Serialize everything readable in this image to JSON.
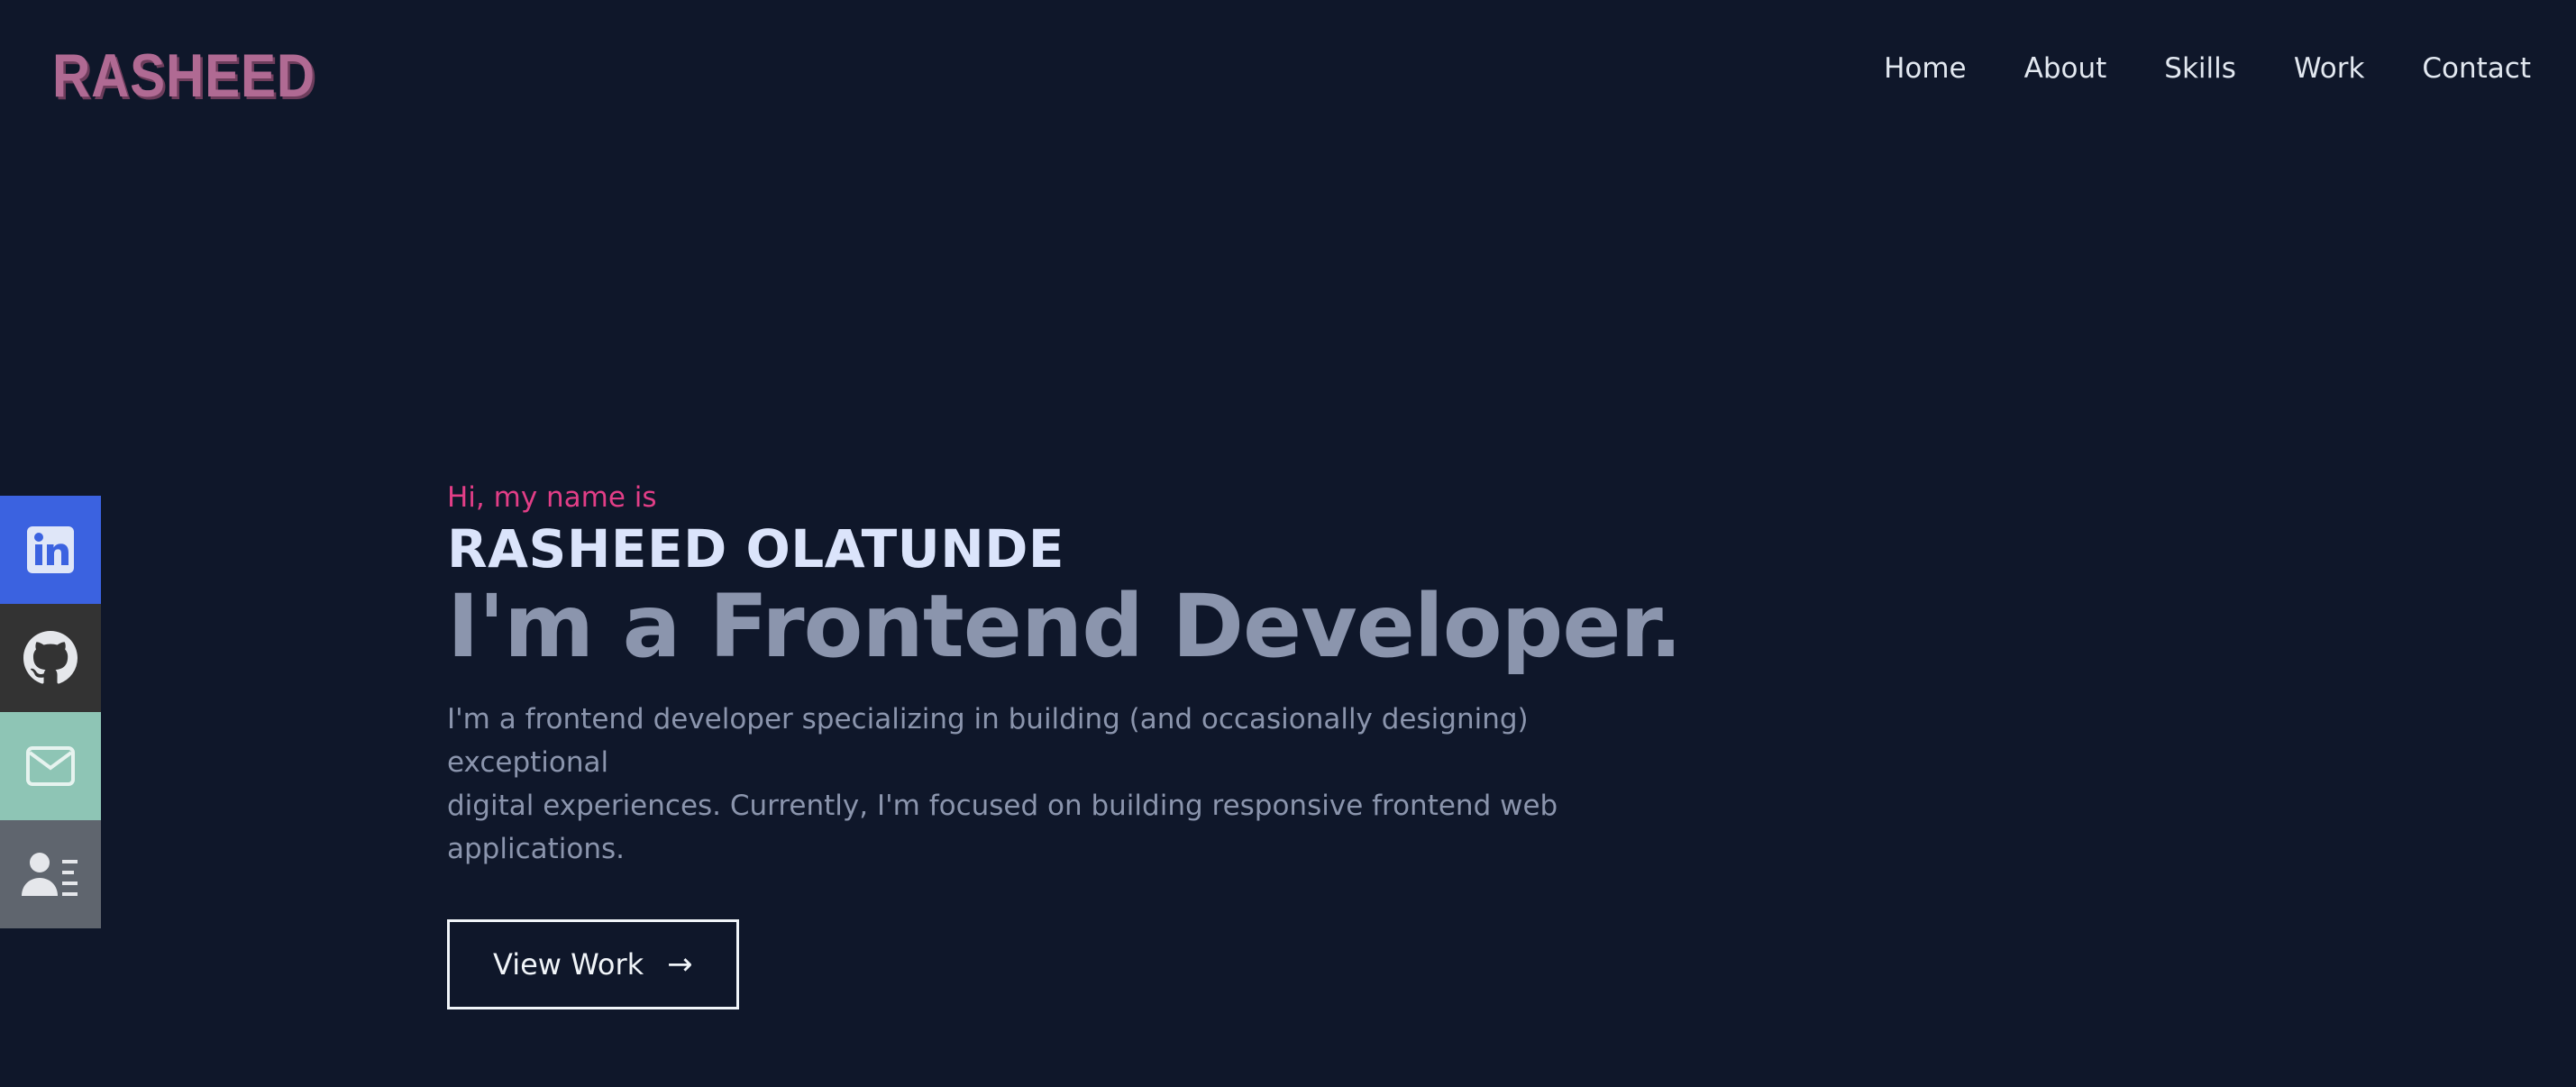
{
  "header": {
    "logo": "RASHEED",
    "nav": [
      "Home",
      "About",
      "Skills",
      "Work",
      "Contact"
    ]
  },
  "social": [
    {
      "icon": "linkedin-icon",
      "color": "#3b62e0"
    },
    {
      "icon": "github-icon",
      "color": "#333333"
    },
    {
      "icon": "mail-icon",
      "color": "#8ec5b5"
    },
    {
      "icon": "resume-icon",
      "color": "#5f656e"
    }
  ],
  "hero": {
    "greeting": "Hi, my name is",
    "name": "RASHEED OLATUNDE",
    "role": "I'm a Frontend Developer.",
    "intro_line1": "I'm a frontend developer specializing in building (and occasionally designing) exceptional",
    "intro_line2": "digital experiences. Currently, I'm focused on building responsive frontend web applications.",
    "cta_label": "View Work",
    "cta_arrow": "→"
  },
  "colors": {
    "background": "#0f172a",
    "accent": "#e23e87",
    "logo": "#b06a93",
    "heading": "#dbe4fb",
    "muted": "#8b95ad"
  }
}
